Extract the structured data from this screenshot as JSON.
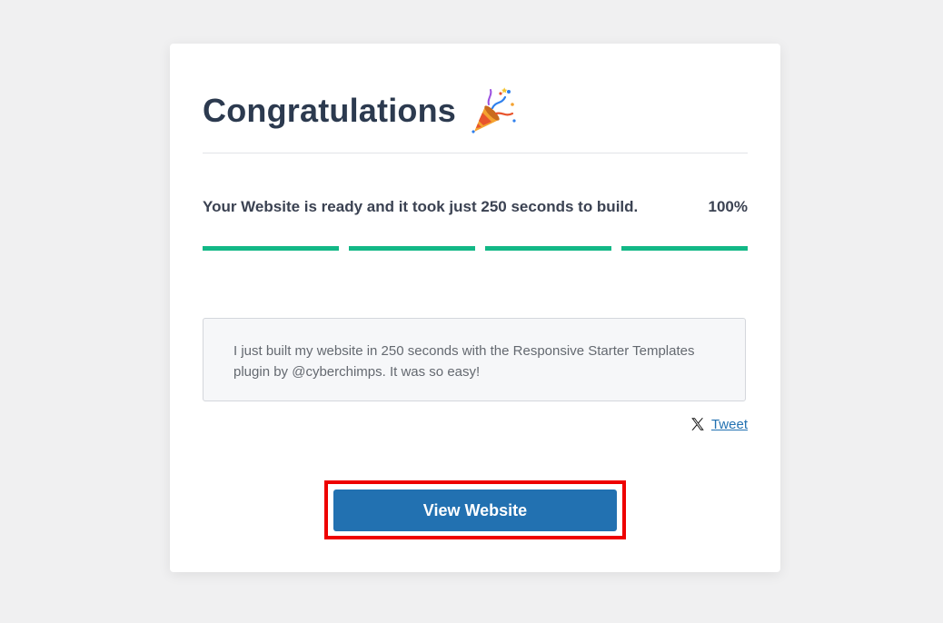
{
  "header": {
    "title": "Congratulations",
    "icon": "party-popper-icon"
  },
  "status": {
    "message": "Your Website is ready and it took just 250 seconds to build.",
    "percent_label": "100%",
    "progress_fraction": 1.0,
    "segment_count": 4,
    "progress_color": "#12b886"
  },
  "tweet": {
    "text": "I just built my website in 250 seconds with the Responsive Starter Templates plugin by @cyberchimps. It was so easy!",
    "link_label": "Tweet",
    "icon": "x-logo-icon"
  },
  "actions": {
    "view_website_label": "View Website",
    "button_color": "#2271b1",
    "highlight_color": "#ee0000"
  }
}
